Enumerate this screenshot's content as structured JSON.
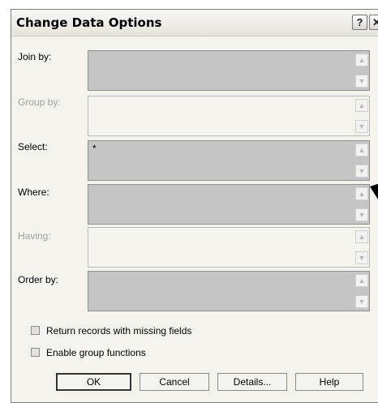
{
  "dialog": {
    "title": "Change Data Options",
    "help_glyph": "?",
    "close_glyph": "✕"
  },
  "fields": [
    {
      "label": "Join by:",
      "value": "",
      "disabled": false
    },
    {
      "label": "Group by:",
      "value": "",
      "disabled": true
    },
    {
      "label": "Select:",
      "value": "*",
      "disabled": false
    },
    {
      "label": "Where:",
      "value": "",
      "disabled": false
    },
    {
      "label": "Having:",
      "value": "",
      "disabled": true
    },
    {
      "label": "Order by:",
      "value": "",
      "disabled": false
    }
  ],
  "scroll_glyphs": {
    "up": "▲",
    "down": "▼"
  },
  "checkboxes": [
    {
      "label": "Return records with missing fields",
      "checked": false
    },
    {
      "label": "Enable group functions",
      "checked": false
    }
  ],
  "buttons": {
    "ok": "OK",
    "cancel": "Cancel",
    "details": "Details...",
    "help": "Help"
  },
  "icons": [
    "help-icon",
    "close-icon",
    "scroll-up-icon",
    "scroll-down-icon",
    "mouse-pointer-icon"
  ]
}
